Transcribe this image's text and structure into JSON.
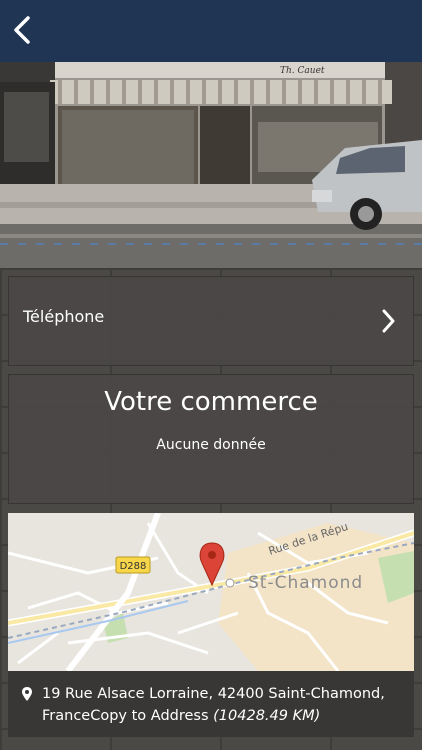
{
  "header": {
    "back_icon": "chevron-left-icon",
    "background_color": "#1f3553"
  },
  "hero": {
    "storefront_sign": "Th. Cauet"
  },
  "phone": {
    "label": "Téléphone",
    "icon": "chevron-right-icon"
  },
  "business": {
    "title": "Votre commerce",
    "subtitle": "Aucune donnée"
  },
  "map": {
    "road_label": "D288",
    "street_label": "Rue de la Répu",
    "city_label": "St-Chamond",
    "marker_icon": "map-marker-icon",
    "marker_color": "#db4437"
  },
  "address": {
    "pin_icon": "location-pin-icon",
    "text": "19 Rue Alsace Lorraine, 42400 Saint-Chamond, France",
    "copy_label": "Copy to Address",
    "distance": "(10428.49 KM)"
  }
}
